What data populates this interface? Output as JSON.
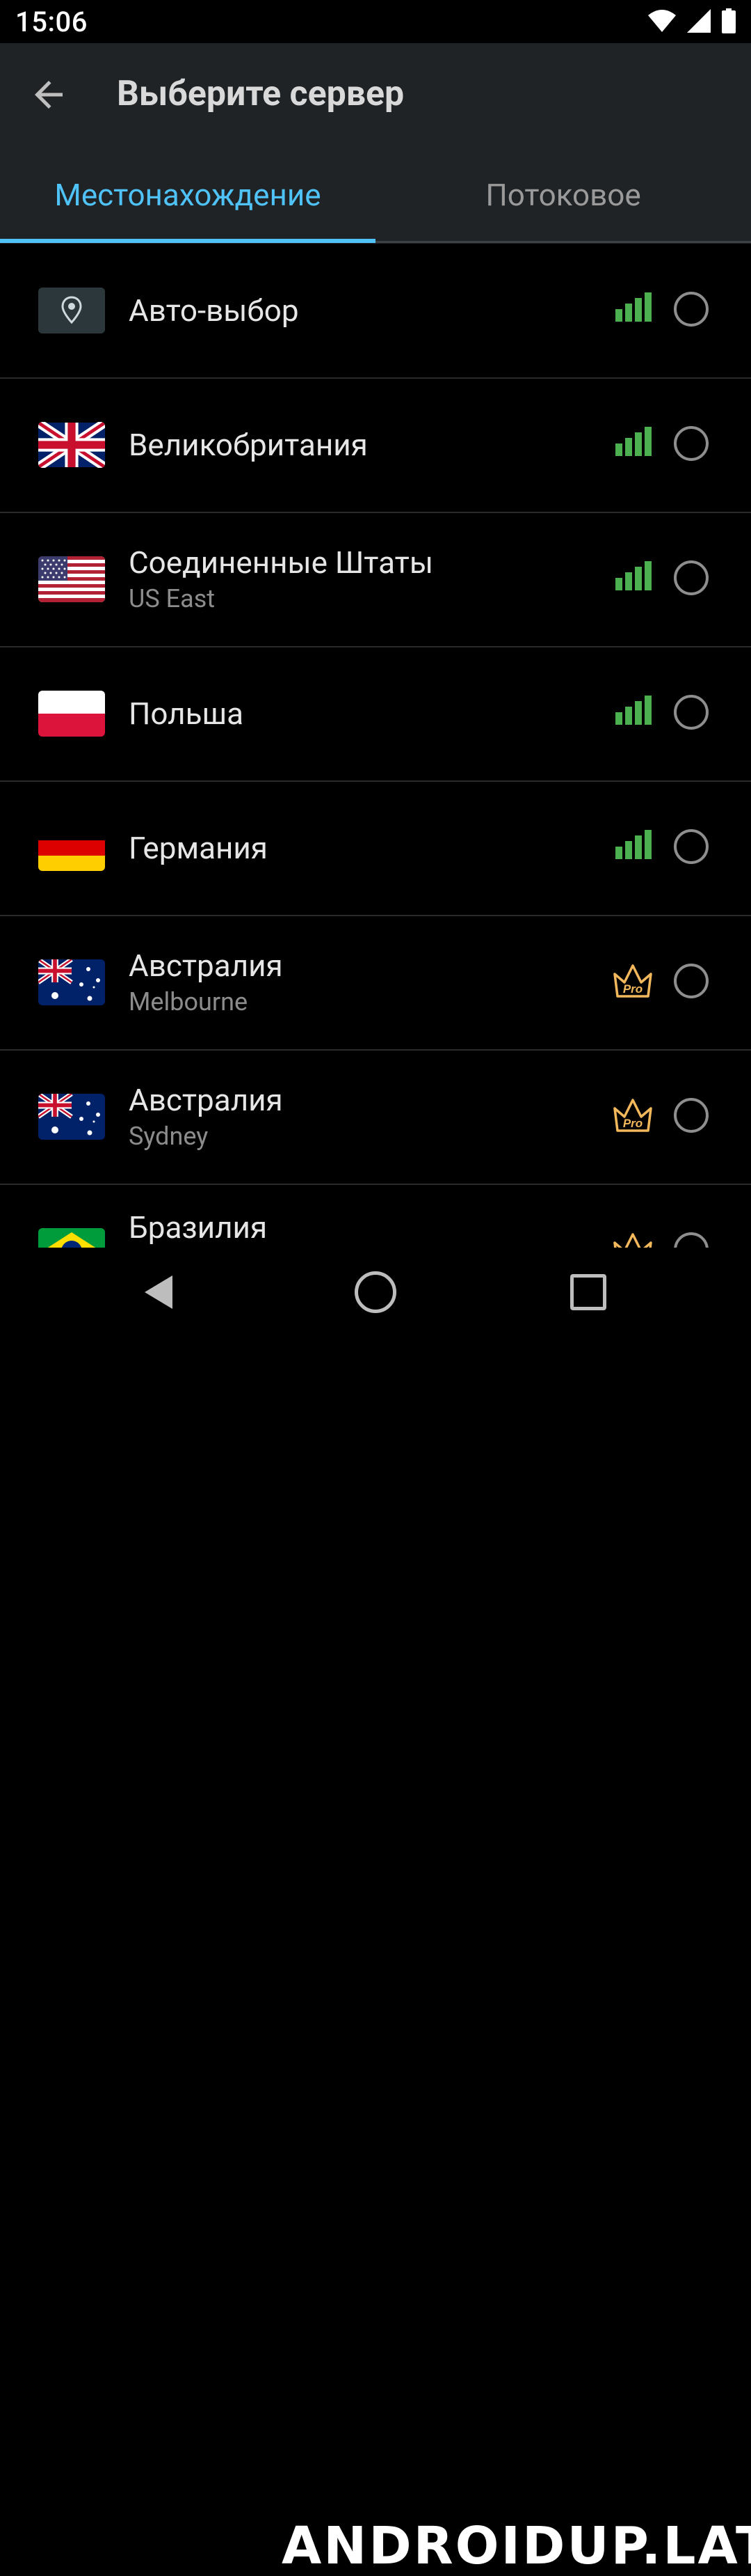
{
  "status_bar": {
    "time": "15:06",
    "icons": [
      "wifi-icon",
      "cell-signal-icon",
      "battery-icon"
    ]
  },
  "app_bar": {
    "title": "Выберите сервер",
    "back_icon": "arrow-back-icon"
  },
  "tabs": [
    {
      "label": "Местонахождение",
      "active": true
    },
    {
      "label": "Потоковое",
      "active": false
    }
  ],
  "colors": {
    "accent": "#4fc3f7",
    "signal_green": "#4caf50",
    "pro_gold": "#f2b85b",
    "toolbar_bg": "#1f2326",
    "background": "#000000"
  },
  "servers": [
    {
      "name": "Авто-выбор",
      "sub": "",
      "flag": "location-pin-icon",
      "badge": "signal"
    },
    {
      "name": "Великобритания",
      "sub": "",
      "flag": "uk-flag-icon",
      "badge": "signal"
    },
    {
      "name": "Соединенные Штаты",
      "sub": "US East",
      "flag": "us-flag-icon",
      "badge": "signal"
    },
    {
      "name": "Польша",
      "sub": "",
      "flag": "poland-flag-icon",
      "badge": "signal"
    },
    {
      "name": "Германия",
      "sub": "",
      "flag": "germany-flag-icon",
      "badge": "signal"
    },
    {
      "name": "Австралия",
      "sub": "Melbourne",
      "flag": "australia-flag-icon",
      "badge": "pro"
    },
    {
      "name": "Австралия",
      "sub": "Sydney",
      "flag": "australia-flag-icon",
      "badge": "pro"
    },
    {
      "name": "Бразилия",
      "sub": "",
      "flag": "brazil-flag-icon",
      "badge": "pro"
    }
  ],
  "pro_label": "Pro",
  "navigation_bar": {
    "icons": [
      "nav-back-icon",
      "nav-home-icon",
      "nav-recents-icon"
    ]
  },
  "watermark": "ANDROIDUP.LAT"
}
